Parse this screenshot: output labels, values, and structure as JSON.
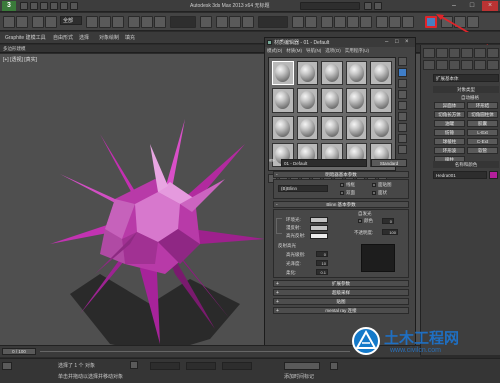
{
  "window": {
    "title": "Autodesk 3ds Max 2013 x64  无标题",
    "app_badge": "3"
  },
  "toolbar": {
    "selection_filter": "全部"
  },
  "ribbon": {
    "tabs": [
      "Graphite 建模工具",
      "自由形式",
      "选择",
      "对象绘制",
      "填充"
    ],
    "sub_label": "多边形建模"
  },
  "viewport": {
    "label": "[+] [透视] [真实]",
    "object_color": "#b62fa6"
  },
  "material_editor": {
    "title": "材质编辑器 - 01 - Default",
    "menu": [
      "模式(D)",
      "材质(M)",
      "导航(N)",
      "选项(O)",
      "实用程序(U)"
    ],
    "material_name": "01 - Default",
    "material_type": "Standard",
    "shader_rollout": "明暗器基本参数",
    "shader_value": "(B)Blinn",
    "shader_options": [
      "线框",
      "双面",
      "面贴图",
      "面状"
    ],
    "blinn_rollout": "Blinn 基本参数",
    "self_illum_label": "自发光",
    "ambient_label": "环境光:",
    "diffuse_label": "漫反射:",
    "specular_label": "高光反射:",
    "color_label": "颜色",
    "color_value": "0",
    "opacity_label": "不透明度:",
    "opacity_value": "100",
    "specular_highlights": "反射高光",
    "spec_level_label": "高光级别:",
    "spec_level_value": "0",
    "glossiness_label": "光泽度:",
    "glossiness_value": "10",
    "soften_label": "柔化:",
    "soften_value": "0.1",
    "rollouts": [
      "扩展参数",
      "超级采样",
      "贴图",
      "mental ray 连接"
    ]
  },
  "command_panel": {
    "dropdown": "扩展基本体",
    "object_type_header": "对象类型",
    "autogrid": "自动栅格",
    "buttons": [
      "异面体",
      "环形结",
      "切角长方体",
      "切角圆柱体",
      "油罐",
      "胶囊",
      "纺锤",
      "L-Ext",
      "球棱柱",
      "C-Ext",
      "环形波",
      "软管",
      "棱柱"
    ],
    "name_color_header": "名称和颜色",
    "object_name": "Hedra001",
    "object_color": "#b41f9c"
  },
  "status": {
    "frame": "0 / 100",
    "selection_text": "选择了 1 个 对象",
    "hint_text": "单击并拖动以选择并移动对象",
    "add_time_tag": "添加时间标记"
  },
  "watermark": {
    "title": "土木工程网",
    "url": "www.civilcn.com"
  }
}
